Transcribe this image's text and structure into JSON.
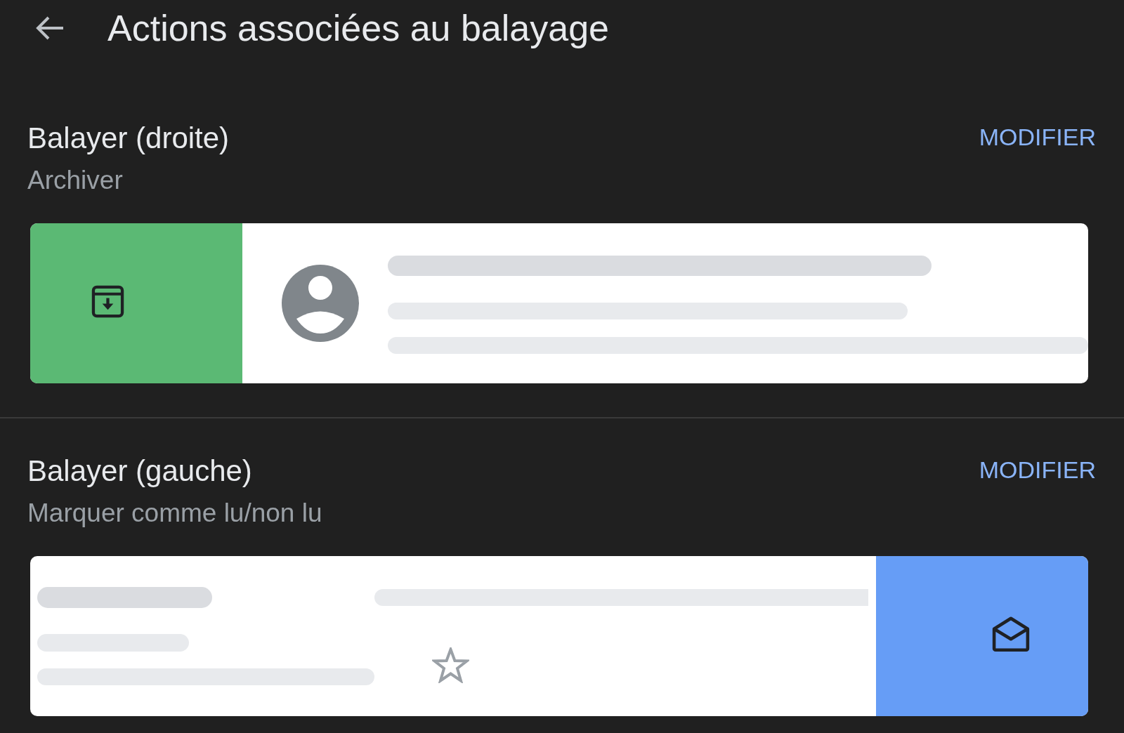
{
  "header": {
    "title": "Actions associées au balayage"
  },
  "swipe_settings": [
    {
      "title": "Balayer (droite)",
      "action": "Archiver",
      "edit_button": "MODIFIER",
      "panel_left": true,
      "kind": "archive",
      "color": "#5bb974"
    },
    {
      "title": "Balayer (gauche)",
      "action": "Marquer comme lu/non lu",
      "edit_button": "MODIFIER",
      "panel_left": false,
      "kind": "mark_read",
      "color": "#669df6"
    }
  ]
}
